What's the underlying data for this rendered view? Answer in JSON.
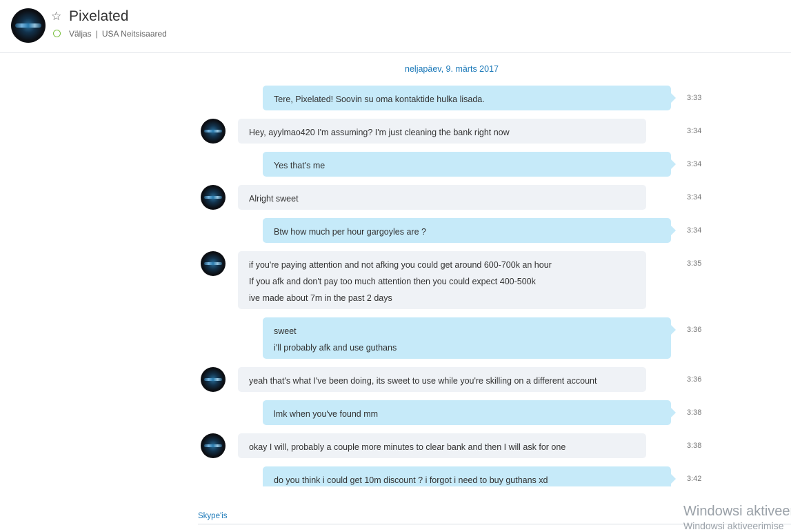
{
  "header": {
    "contact_name": "Pixelated",
    "status": "Väljas",
    "separator": "|",
    "location": "USA Neitsisaared"
  },
  "date_separator": "neljapäev, 9. märts 2017",
  "messages": [
    {
      "direction": "out",
      "lines": [
        "Tere, Pixelated! Soovin su oma kontaktide hulka lisada."
      ],
      "time": "3:33"
    },
    {
      "direction": "in",
      "lines": [
        "Hey, ayylmao420 I'm assuming? I'm just cleaning the bank right now"
      ],
      "time": "3:34"
    },
    {
      "direction": "out",
      "lines": [
        "Yes that's me"
      ],
      "time": "3:34"
    },
    {
      "direction": "in",
      "lines": [
        "Alright sweet"
      ],
      "time": "3:34"
    },
    {
      "direction": "out",
      "lines": [
        "Btw how much per hour gargoyles are ?"
      ],
      "time": "3:34"
    },
    {
      "direction": "in",
      "lines": [
        "if you're paying attention and not afking you could get around 600-700k an hour",
        "If you afk and don't pay too much attention then you could expect 400-500k",
        "ive made about 7m in the past 2 days"
      ],
      "time": "3:35"
    },
    {
      "direction": "out",
      "lines": [
        "sweet",
        "i'll probably afk and use guthans"
      ],
      "time": "3:36"
    },
    {
      "direction": "in",
      "lines": [
        "yeah that's what I've been doing, its sweet to use while you're skilling on a different account"
      ],
      "time": "3:36"
    },
    {
      "direction": "out",
      "lines": [
        "lmk when you've found mm"
      ],
      "time": "3:38"
    },
    {
      "direction": "in",
      "lines": [
        "okay I will, probably a couple more minutes to clear bank and then I will ask for one"
      ],
      "time": "3:38"
    },
    {
      "direction": "out",
      "lines": [
        "do you think i could get 10m discount ? i forgot i need to buy guthans xd"
      ],
      "time": "3:42"
    }
  ],
  "footer": {
    "skype_link": "Skype'is"
  },
  "watermark": {
    "line1": "Windowsi aktiveer",
    "line2": "Windowsi aktiveerimise"
  },
  "colors": {
    "outgoing_bubble": "#c6eaf9",
    "incoming_bubble": "#eff2f6",
    "accent": "#1a78b8",
    "presence_away": "#7cc142"
  }
}
